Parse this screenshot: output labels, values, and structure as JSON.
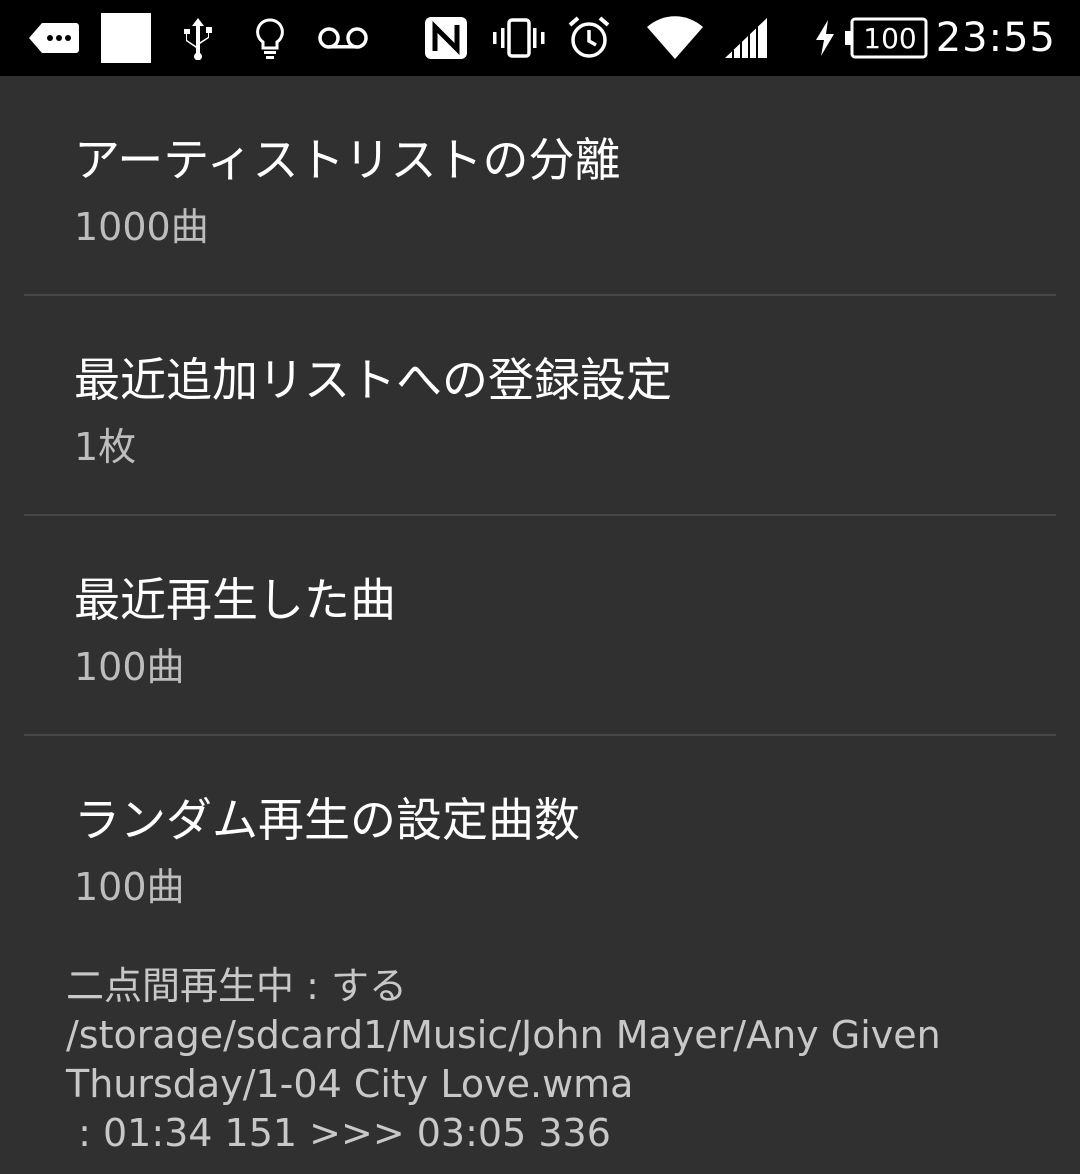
{
  "status_bar": {
    "time": "23:55",
    "battery_level": "100",
    "icons": [
      "more-notifications-icon",
      "white-square-icon",
      "usb-icon",
      "bulb-icon",
      "voicemail-icon",
      "nfc-icon",
      "vibrate-icon",
      "alarm-icon",
      "wifi-icon",
      "signal-icon",
      "charging-icon",
      "battery-icon"
    ]
  },
  "settings": {
    "items": [
      {
        "title": "アーティストリストの分離",
        "summary": "1000曲"
      },
      {
        "title": "最近追加リストへの登録設定",
        "summary": "1枚"
      },
      {
        "title": "最近再生した曲",
        "summary": "100曲"
      },
      {
        "title": "ランダム再生の設定曲数",
        "summary": "100曲"
      }
    ]
  },
  "debug": {
    "line1": "二点間再生中 : する",
    "line2": "/storage/sdcard1/Music/John Mayer/Any Given",
    "line3": "Thursday/1-04 City Love.wma",
    "line4": " : 01:34 151 >>> 03:05 336"
  }
}
